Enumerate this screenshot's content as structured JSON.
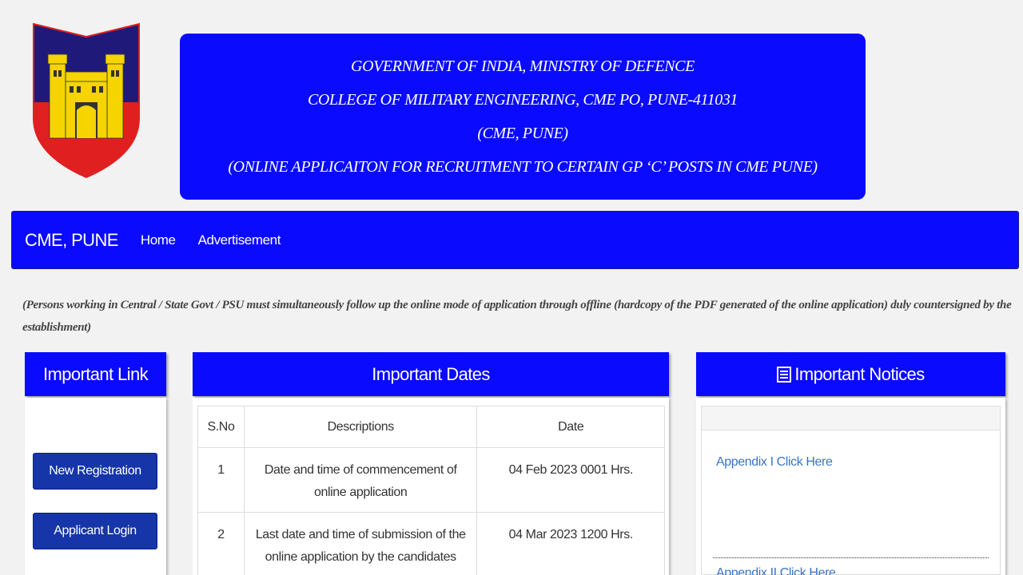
{
  "header": {
    "line1": "GOVERNMENT OF INDIA, MINISTRY OF DEFENCE",
    "line2": "COLLEGE OF MILITARY ENGINEERING, CME PO, PUNE-411031",
    "line3": "(CME, PUNE)",
    "line4": "(ONLINE APPLICAITON FOR RECRUITMENT TO CERTAIN GP ‘C’ POSTS IN CME PUNE)"
  },
  "nav": {
    "brand": "CME, PUNE",
    "links": [
      "Home",
      "Advertisement"
    ]
  },
  "notice": "(Persons working in Central / State Govt / PSU must simultaneously follow up the online mode of application through offline (hardcopy of the PDF generated of the online application) duly countersigned by the establishment)",
  "important_link": {
    "title": "Important Link",
    "buttons": [
      "New Registration",
      "Applicant Login"
    ]
  },
  "important_dates": {
    "title": "Important Dates",
    "columns": [
      "S.No",
      "Descriptions",
      "Date"
    ],
    "rows": [
      [
        "1",
        "Date and time of commencement of online application",
        "04 Feb 2023 0001 Hrs."
      ],
      [
        "2",
        "Last date and time of submission of the online application by the candidates",
        "04 Mar 2023 1200 Hrs."
      ]
    ]
  },
  "important_notices": {
    "title": "Important Notices",
    "icon": "list-icon",
    "links": [
      "Appendix I Click Here",
      "Appendix II Click Here"
    ]
  },
  "colors": {
    "brand_blue": "#0a0aff",
    "button_blue": "#1535a8",
    "link_blue": "#3a74c4"
  }
}
